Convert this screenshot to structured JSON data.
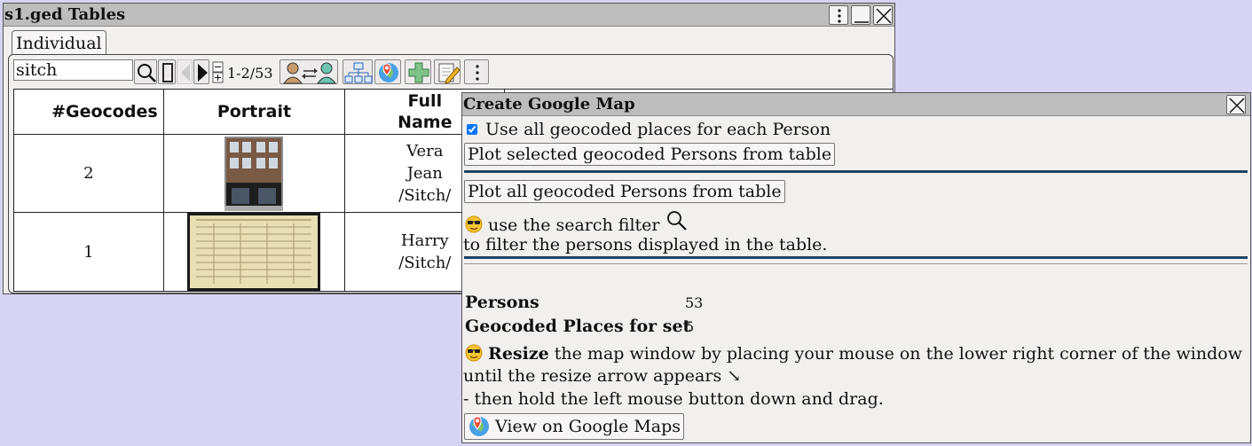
{
  "main_window": {
    "title": "s1.ged Tables",
    "tab_label": "Individual",
    "search_value": "sitch",
    "range_text": "1-2/53",
    "columns": [
      "#Geocodes",
      "Portrait",
      "Full Name"
    ],
    "rows": [
      {
        "geocodes": "2",
        "portrait": "house-photo",
        "full_name": "Vera Jean /Sitch/"
      },
      {
        "geocodes": "1",
        "portrait": "census-document",
        "full_name": "Harry /Sitch/"
      }
    ]
  },
  "dialog": {
    "title": "Create Google Map",
    "checkbox_label": "Use all geocoded places for each Person",
    "checkbox_checked": true,
    "plot_selected_label": "Plot selected geocoded Persons from table",
    "plot_all_label": "Plot all geocoded Persons from table",
    "filter_hint_line1": "use the search filter",
    "filter_hint_line2": "to filter the persons displayed in the table.",
    "persons_label": "Persons",
    "persons_value": "53",
    "places_label": "Geocoded Places for set",
    "places_value": "5",
    "resize_bold": "Resize",
    "resize_text": "the map window by placing your mouse on the lower right corner of the window",
    "resize_line2": "until the resize arrow appears ↘",
    "resize_line3": "- then hold the left mouse button down and drag.",
    "view_button_label": "View on Google Maps"
  },
  "icons": [
    "search-icon",
    "column-icon",
    "prev-icon",
    "next-icon",
    "expand-icon",
    "swap-person-icon",
    "tree-icon",
    "map-pin-icon",
    "add-icon",
    "edit-icon",
    "more-icon",
    "close-icon",
    "minimize-icon",
    "cool-emoji-icon"
  ]
}
